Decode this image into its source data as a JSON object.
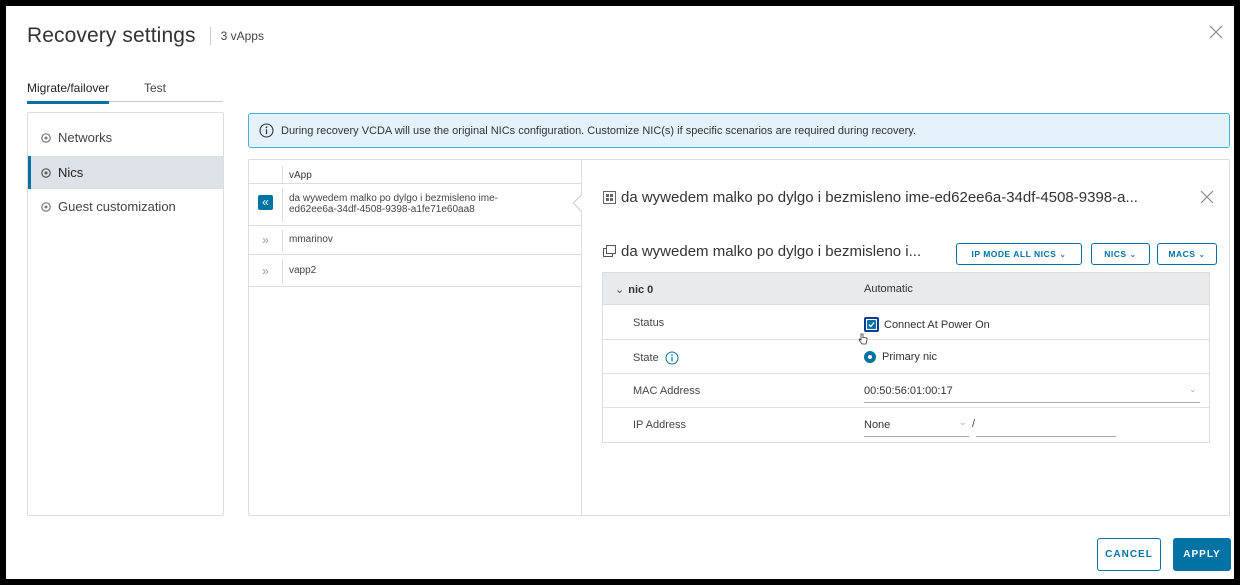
{
  "dialog": {
    "title": "Recovery settings",
    "subtitle": "3 vApps",
    "close_icon": "close-icon"
  },
  "tabs": [
    {
      "label": "Migrate/failover",
      "active": true
    },
    {
      "label": "Test",
      "active": false
    }
  ],
  "sidebar": {
    "items": [
      {
        "label": "Networks",
        "icon": "gear-icon",
        "active": false
      },
      {
        "label": "Nics",
        "icon": "gear-icon",
        "active": true
      },
      {
        "label": "Guest customization",
        "icon": "gear-icon",
        "active": false
      }
    ]
  },
  "banner": {
    "text": "During recovery VCDA will use the original NICs configuration. Customize NIC(s) if specific scenarios are required during recovery.",
    "icon": "info-icon"
  },
  "grid": {
    "column_header": "vApp",
    "rows": [
      {
        "line1": "da wywedem malko po dylgo i bezmisleno ime-",
        "line2": "ed62ee6a-34df-4508-9398-a1fe71e60aa8",
        "toggle": "«",
        "selected": true
      },
      {
        "line1": "mmarinov",
        "line2": "",
        "toggle": "»",
        "selected": false
      },
      {
        "line1": "vapp2",
        "line2": "",
        "toggle": "»",
        "selected": false
      }
    ]
  },
  "detail": {
    "title": "da wywedem malko po dylgo i bezmisleno ime-ed62ee6a-34df-4508-9398-a...",
    "vm_name": "da wywedem malko po dylgo i bezmisleno i...",
    "buttons": {
      "ip_mode": "IP MODE ALL NICS",
      "nics": "NICS",
      "macs": "MACS"
    },
    "nic": {
      "name": "nic 0",
      "mode": "Automatic",
      "rows": {
        "status_label": "Status",
        "status_value": "Connect At Power On",
        "state_label": "State",
        "state_value": "Primary nic",
        "mac_label": "MAC Address",
        "mac_value": "00:50:56:01:00:17",
        "ip_label": "IP Address",
        "ip_value": "None",
        "ip_separator": "/"
      }
    }
  },
  "footer": {
    "cancel": "CANCEL",
    "apply": "APPLY"
  },
  "colors": {
    "accent": "#0072a3",
    "banner_bg": "#e3f2fb",
    "banner_border": "#49afd9",
    "selected_nav_bg": "#dde2e8"
  }
}
